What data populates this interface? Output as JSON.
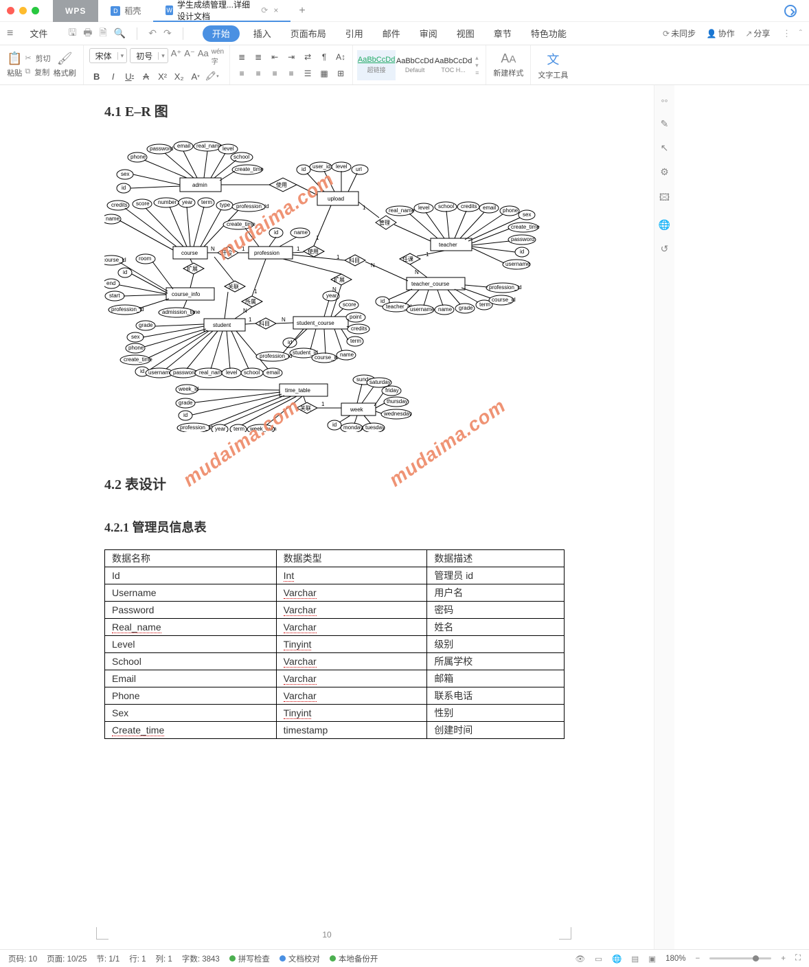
{
  "title": {
    "tab_wps": "WPS",
    "tab_daoke": "稻壳",
    "tab_doc": "学生成绩管理...详细设计文档",
    "newtab": "+"
  },
  "menu": {
    "file": "文件",
    "items": [
      "开始",
      "插入",
      "页面布局",
      "引用",
      "邮件",
      "审阅",
      "视图",
      "章节",
      "特色功能"
    ],
    "sync": "未同步",
    "collab": "协作",
    "share": "分享"
  },
  "ribbon": {
    "paste": "粘贴",
    "cut": "剪切",
    "copy": "复制",
    "brush": "格式刷",
    "font_name": "宋体",
    "font_size": "初号",
    "styles": [
      {
        "prev": "AaBbCcDd",
        "label": "超链接",
        "link": true
      },
      {
        "prev": "AaBbCcDd",
        "label": "Default"
      },
      {
        "prev": "AaBbCcDd",
        "label": "TOC H..."
      }
    ],
    "new_style": "新建样式",
    "text_tools": "文字工具"
  },
  "doc": {
    "h1": "4.1 E–R 图",
    "h2": "4.2 表设计",
    "h3": "4.2.1 管理员信息表",
    "watermark": "mudaima.com",
    "pagenum": "10",
    "table": {
      "header": [
        "数据名称",
        "数据类型",
        "数据描述"
      ],
      "rows": [
        [
          "Id",
          "Int",
          "管理员 id"
        ],
        [
          "Username",
          "Varchar",
          "用户名"
        ],
        [
          "Password",
          "Varchar",
          "密码"
        ],
        [
          "Real_name",
          "Varchar",
          "姓名"
        ],
        [
          "Level",
          "Tinyint",
          "级别"
        ],
        [
          "School",
          "Varchar",
          "所属学校"
        ],
        [
          "Email",
          "Varchar",
          "邮箱"
        ],
        [
          "Phone",
          "Varchar",
          "联系电话"
        ],
        [
          "Sex",
          "Tinyint",
          "性别"
        ],
        [
          "Create_time",
          "timestamp",
          "创建时间"
        ]
      ]
    },
    "er_entities": [
      "admin",
      "upload",
      "profession",
      "course",
      "course_info",
      "student",
      "student_course",
      "teacher",
      "teacher_course",
      "time_table",
      "week"
    ],
    "er_attrs": {
      "admin": [
        "id",
        "sex",
        "phone",
        "password",
        "email",
        "real_name",
        "level",
        "school",
        "create_time"
      ],
      "upload": [
        "id",
        "user_id",
        "level",
        "url"
      ],
      "profession": [
        "id",
        "name",
        "create_time"
      ],
      "course": [
        "credits",
        "name",
        "score",
        "number",
        "year",
        "term",
        "type",
        "profession_id"
      ],
      "course_info": [
        "course_id",
        "id",
        "room",
        "end",
        "start",
        "profession_id",
        "admission_time"
      ],
      "student": [
        "grade",
        "sex",
        "phone",
        "create_time",
        "id",
        "username",
        "password",
        "real_name",
        "level",
        "school",
        "email"
      ],
      "student_course": [
        "year",
        "score",
        "point",
        "credits",
        "term",
        "id",
        "student_id",
        "course_id",
        "name",
        "profession_id"
      ],
      "teacher": [
        "real_name",
        "level",
        "school",
        "credits",
        "email",
        "phone",
        "sex",
        "create_time",
        "password",
        "id",
        "username"
      ],
      "teacher_course": [
        "id",
        "teacher_id",
        "username",
        "name",
        "grade",
        "term",
        "course_id",
        "profession_id"
      ],
      "time_table": [
        "week_id",
        "grade",
        "id",
        "profession_id",
        "year",
        "term",
        "week_num"
      ],
      "week": [
        "sunday",
        "saturday",
        "friday",
        "thursday",
        "wednesday",
        "id",
        "monday",
        "tuesday"
      ]
    },
    "er_rels": [
      "使用",
      "管理",
      "使用",
      "扩展",
      "开设",
      "扩展",
      "所属",
      "任课",
      "科目",
      "关联",
      "关联"
    ]
  },
  "status": {
    "pageno": "页码: 10",
    "pages": "页面: 10/25",
    "sec": "节: 1/1",
    "row": "行: 1",
    "col": "列: 1",
    "words": "字数: 3843",
    "spell": "拼写检查",
    "proof": "文档校对",
    "backup": "本地备份开",
    "zoom": "180%"
  }
}
